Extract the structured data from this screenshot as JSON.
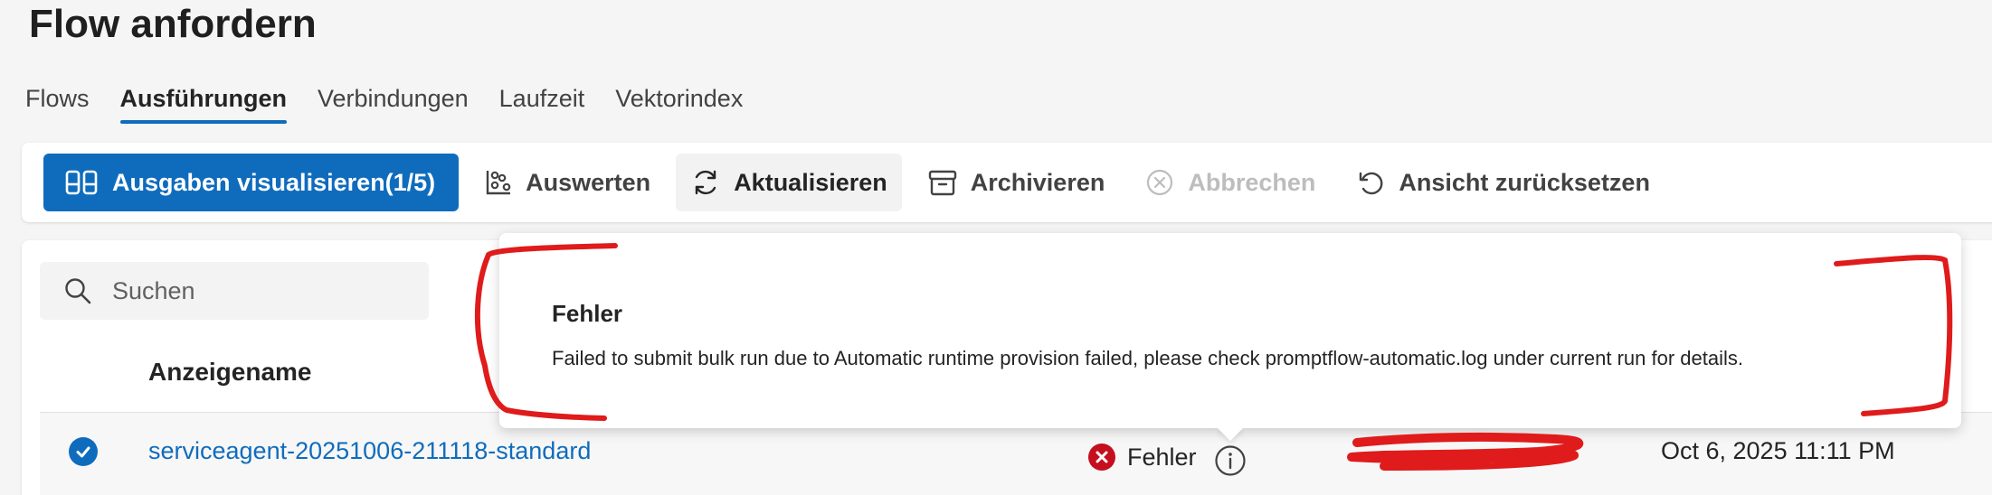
{
  "page": {
    "title": "Flow anfordern"
  },
  "tabs": [
    {
      "label": "Flows",
      "active": false
    },
    {
      "label": "Ausführungen",
      "active": true
    },
    {
      "label": "Verbindungen",
      "active": false
    },
    {
      "label": "Laufzeit",
      "active": false
    },
    {
      "label": "Vektorindex",
      "active": false
    }
  ],
  "toolbar": {
    "visualize_label": "Ausgaben visualisieren(1/5)",
    "evaluate_label": "Auswerten",
    "refresh_label": "Aktualisieren",
    "archive_label": "Archivieren",
    "cancel_label": "Abbrechen",
    "reset_view_label": "Ansicht zurücksetzen"
  },
  "search": {
    "placeholder": "Suchen"
  },
  "table": {
    "columns": [
      "Anzeigename"
    ],
    "rows": [
      {
        "name": "serviceagent-20251006-211118-standard",
        "status": "Fehler",
        "date": "Oct 6, 2025 11:11 PM",
        "selected": true
      }
    ]
  },
  "tooltip": {
    "title": "Fehler",
    "message": "Failed to submit bulk run due to Automatic runtime provision failed, please check promptflow-automatic.log under current run for details."
  },
  "colors": {
    "accent": "#0f6cbd",
    "error": "#c50f1f",
    "annotation": "#e01b1b"
  },
  "icons": {
    "visualize": "compare-columns-icon",
    "evaluate": "scatter-icon",
    "refresh": "refresh-icon",
    "archive": "archive-icon",
    "cancel": "dismiss-circle-icon",
    "reset": "undo-icon",
    "search": "search-icon",
    "status": "error-circle-icon",
    "info": "info-icon",
    "checkbox": "checkmark-icon"
  }
}
